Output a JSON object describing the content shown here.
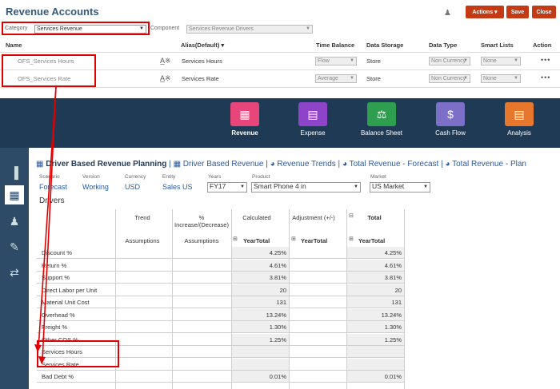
{
  "header": {
    "title": "Revenue Accounts",
    "actions_label": "Actions",
    "save_label": "Save",
    "close_label": "Close"
  },
  "filters": {
    "category_label": "Category",
    "category_value": "Services Revenue",
    "component_label": "Component",
    "component_value": "Services Revenue Drivers"
  },
  "table": {
    "columns": [
      "Name",
      "Alias(Default)",
      "Time Balance",
      "Data Storage",
      "Data Type",
      "Smart Lists",
      "Action"
    ],
    "rows": [
      {
        "name": "OFS_Services Hours",
        "alias": "Services Hours",
        "time_balance": "Flow",
        "storage": "Store",
        "data_type": "Non Currency",
        "smart_list": "None",
        "action": "•••"
      },
      {
        "name": "OFS_Services Rate",
        "alias": "Services Rate",
        "time_balance": "Average",
        "storage": "Store",
        "data_type": "Non Currency",
        "smart_list": "None",
        "action": "•••"
      }
    ]
  },
  "nav": [
    {
      "label": "Revenue",
      "color": "#e8457a",
      "icon": "register-icon"
    },
    {
      "label": "Expense",
      "color": "#8e44c8",
      "icon": "card-icon"
    },
    {
      "label": "Balance Sheet",
      "color": "#2e9e4f",
      "icon": "scale-icon"
    },
    {
      "label": "Cash Flow",
      "color": "#7b6fc8",
      "icon": "cash-icon"
    },
    {
      "label": "Analysis",
      "color": "#e8772e",
      "icon": "chart-icon"
    }
  ],
  "tabs": {
    "active": "Driver Based Revenue Planning",
    "t1": "Driver Based Revenue",
    "t2": "Revenue Trends",
    "t3": "Total Revenue - Forecast",
    "t4": "Total Revenue - Plan"
  },
  "pov": {
    "scenario_label": "Scenario",
    "scenario": "Forecast",
    "version_label": "Version",
    "version": "Working",
    "currency_label": "Currency",
    "currency": "USD",
    "entity_label": "Entity",
    "entity": "Sales US",
    "years_label": "Years",
    "years": "FY17",
    "product_label": "Product",
    "product": "Smart Phone 4 in",
    "market_label": "Market",
    "market": "US Market"
  },
  "grid": {
    "title": "Drivers",
    "h_trend": "Trend",
    "h_pct": "% Increase/(Decrease)",
    "h_calc": "Calculated",
    "h_adj": "Adjustment (+/-)",
    "h_total": "Total",
    "sub_assump1": "Assumptions",
    "sub_assump2": "Assumptions",
    "sub_year1": "YearTotal",
    "sub_year2": "YearTotal",
    "sub_year3": "YearTotal",
    "rows": [
      {
        "label": "Discount %",
        "calc": "4.25%",
        "total": "4.25%"
      },
      {
        "label": "Return %",
        "calc": "4.61%",
        "total": "4.61%"
      },
      {
        "label": "Support %",
        "calc": "3.81%",
        "total": "3.81%"
      },
      {
        "label": "Direct Labor per Unit",
        "calc": "20",
        "total": "20"
      },
      {
        "label": "Material Unit Cost",
        "calc": "131",
        "total": "131"
      },
      {
        "label": "Overhead %",
        "calc": "13.24%",
        "total": "13.24%"
      },
      {
        "label": "Freight %",
        "calc": "1.30%",
        "total": "1.30%"
      },
      {
        "label": "Other COS %",
        "calc": "1.25%",
        "total": "1.25%"
      },
      {
        "label": "Services Hours",
        "calc": "",
        "total": ""
      },
      {
        "label": "Services Rate",
        "calc": "",
        "total": ""
      },
      {
        "label": "Bad Debt %",
        "calc": "0.01%",
        "total": "0.01%"
      }
    ]
  },
  "colors": {
    "accent": "#c33a14",
    "highlight": "#e00000",
    "nav_bg": "#1f3a55"
  }
}
